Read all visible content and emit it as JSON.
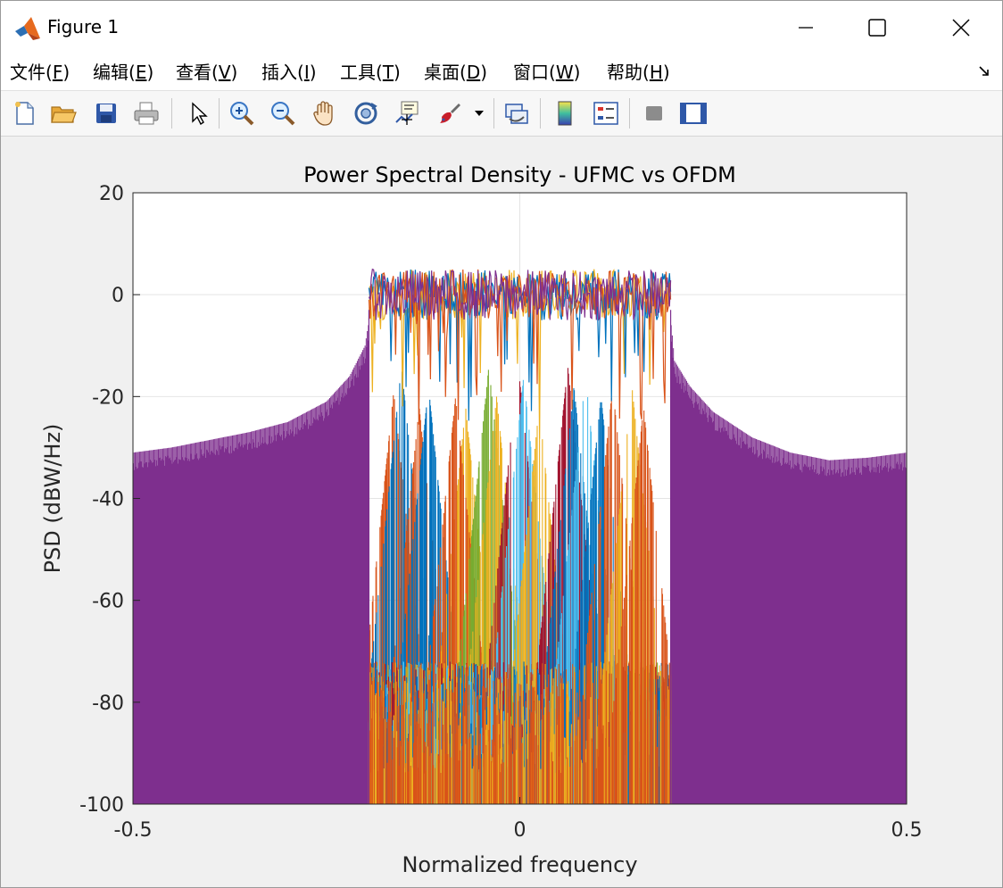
{
  "window": {
    "title": "Figure 1",
    "icon": "matlab-logo-icon",
    "controls": [
      "minimize-icon",
      "maximize-icon",
      "close-icon"
    ]
  },
  "menu": {
    "items": [
      {
        "label": "文件(",
        "key": "F",
        "tail": ")"
      },
      {
        "label": "编辑(",
        "key": "E",
        "tail": ")"
      },
      {
        "label": "查看(",
        "key": "V",
        "tail": ")"
      },
      {
        "label": "插入(",
        "key": "I",
        "tail": ")"
      },
      {
        "label": "工具(",
        "key": "T",
        "tail": ")"
      },
      {
        "label": "桌面(",
        "key": "D",
        "tail": ")"
      },
      {
        "label": "窗口(",
        "key": "W",
        "tail": ")"
      },
      {
        "label": "帮助(",
        "key": "H",
        "tail": ")"
      }
    ]
  },
  "toolbar": {
    "icons": [
      "new-file-icon",
      "open-folder-icon",
      "save-icon",
      "print-icon",
      "pointer-icon",
      "zoom-in-icon",
      "zoom-out-icon",
      "pan-hand-icon",
      "rotate-3d-icon",
      "data-cursor-icon",
      "brush-icon",
      "link-plot-icon",
      "colorbar-icon",
      "legend-icon",
      "hide-plot-tools-icon",
      "show-plot-tools-icon"
    ]
  },
  "colors": {
    "ofdm": "#7E2F8E",
    "blue": "#0072BD",
    "orange": "#D95319",
    "yellow": "#EDB120",
    "green": "#77AC30",
    "cyan": "#4DBEEE",
    "red": "#A2142F"
  },
  "chart_data": {
    "type": "line",
    "title": "Power Spectral Density - UFMC vs OFDM",
    "xlabel": "Normalized frequency",
    "ylabel": "PSD (dBW/Hz)",
    "xlim": [
      -0.5,
      0.5
    ],
    "ylim": [
      -100,
      20
    ],
    "xticks": [
      -0.5,
      0,
      0.5
    ],
    "xtick_labels": [
      "-0.5",
      "0",
      "0.5"
    ],
    "yticks": [
      20,
      0,
      -20,
      -40,
      -60,
      -80,
      -100
    ],
    "ytick_labels": [
      "20",
      "0",
      "-20",
      "-40",
      "-60",
      "-80",
      "-100"
    ],
    "grid": true,
    "legend": "none",
    "passband": [
      -0.195,
      0.195
    ],
    "ofdm_envelope": {
      "x": [
        -0.5,
        -0.45,
        -0.4,
        -0.35,
        -0.3,
        -0.25,
        -0.22,
        -0.2,
        -0.196,
        0.196,
        0.2,
        0.22,
        0.25,
        0.3,
        0.35,
        0.4,
        0.45,
        0.5
      ],
      "y": [
        -31,
        -30,
        -28.5,
        -27,
        -25,
        -21,
        -16,
        -10,
        -6,
        -6,
        -13,
        -18,
        -23,
        -28,
        -31,
        -32.5,
        -32,
        -31
      ]
    },
    "subbands": [
      {
        "color_key": "orange",
        "center": -0.163,
        "peak": -19
      },
      {
        "color_key": "blue",
        "center": -0.153,
        "peak": -14
      },
      {
        "color_key": "orange",
        "center": -0.13,
        "peak": -22
      },
      {
        "color_key": "blue",
        "center": -0.118,
        "peak": -18
      },
      {
        "color_key": "yellow",
        "center": -0.07,
        "peak": -22
      },
      {
        "color_key": "orange",
        "center": -0.083,
        "peak": -20
      },
      {
        "color_key": "green",
        "center": -0.04,
        "peak": -14
      },
      {
        "color_key": "yellow",
        "center": -0.03,
        "peak": -20
      },
      {
        "color_key": "red",
        "center": -0.002,
        "peak": -14
      },
      {
        "color_key": "cyan",
        "center": 0.005,
        "peak": -16
      },
      {
        "color_key": "yellow",
        "center": 0.025,
        "peak": -22
      },
      {
        "color_key": "red",
        "center": 0.062,
        "peak": -14
      },
      {
        "color_key": "blue",
        "center": 0.07,
        "peak": -18
      },
      {
        "color_key": "cyan",
        "center": 0.085,
        "peak": -16
      },
      {
        "color_key": "blue",
        "center": 0.105,
        "peak": -20
      },
      {
        "color_key": "orange",
        "center": 0.12,
        "peak": -18
      },
      {
        "color_key": "yellow",
        "center": 0.145,
        "peak": -18
      },
      {
        "color_key": "orange",
        "center": 0.16,
        "peak": -22
      }
    ],
    "inband_level": {
      "mean": 0,
      "ripple": 5
    }
  }
}
